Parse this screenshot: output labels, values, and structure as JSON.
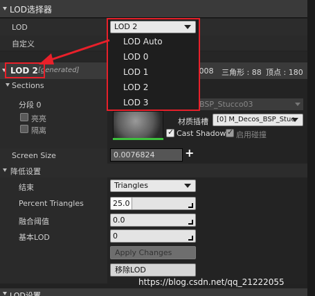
{
  "panel": {
    "title": "LOD选择器",
    "lod_label": "LOD",
    "lod_value": "LOD 2",
    "custom_label": "自定义",
    "lod_options": [
      "LOD Auto",
      "LOD 0",
      "LOD 1",
      "LOD 2",
      "LOD 3"
    ]
  },
  "lod_section": {
    "title": "LOD 2",
    "generated": "[generated]",
    "stats_prefix": ".008",
    "triangles_label": "三角形 : 88",
    "vertices_label": "顶点 : 180"
  },
  "sections": {
    "label": "Sections",
    "section0": "分段 0",
    "highlight": "亮亮",
    "isolate": "隔离",
    "material_name": "BSP_Stucco03",
    "material_slot_label": "材质插槽",
    "material_slot_value": "[0] M_Decos_BSP_Stuc",
    "cast_shadow": "Cast Shadow",
    "enable_collision": "启用碰撞"
  },
  "screen_size": {
    "label": "Screen Size",
    "value": "0.0076824",
    "add": "+"
  },
  "reduction": {
    "header": "降低设置",
    "termination_label": "结束",
    "termination_value": "Triangles",
    "percent_label": "Percent Triangles",
    "percent_value": "25.0",
    "percent_fill": 0.25,
    "weld_label": "融合阈值",
    "weld_value": "0.0",
    "base_lod_label": "基本LOD",
    "base_lod_value": "0",
    "apply_button": "Apply Changes",
    "remove_button": "移除LOD"
  },
  "footer": {
    "next_header": "LOD设置",
    "watermark": "https://blog.csdn.net/qq_21222055"
  },
  "colors": {
    "annotation_red": "#e8202a"
  }
}
